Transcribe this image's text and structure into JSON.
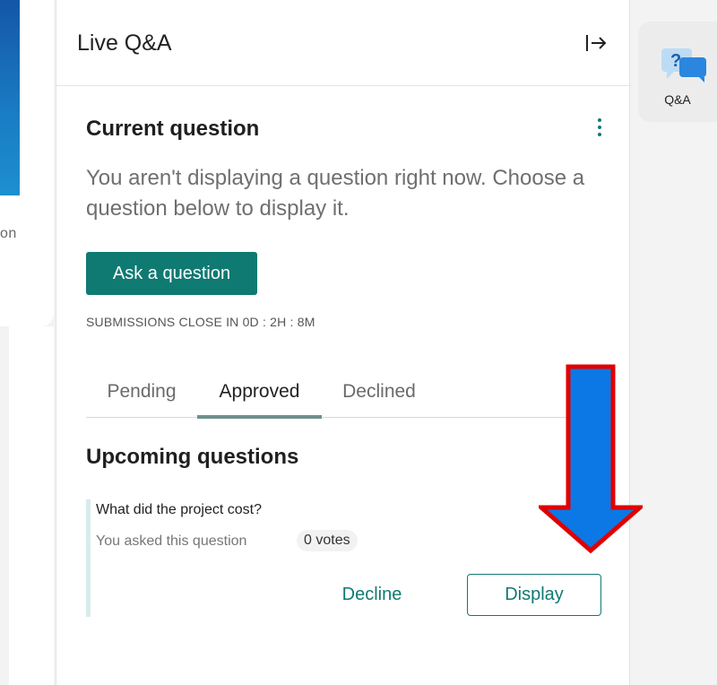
{
  "left_peek": {
    "text": "on"
  },
  "panel": {
    "title": "Live Q&A"
  },
  "current": {
    "title": "Current question",
    "message": "You aren't displaying a question right now. Choose a question below to display it.",
    "ask_button": "Ask a question",
    "countdown": "SUBMISSIONS CLOSE IN 0D : 2H : 8M"
  },
  "tabs": [
    {
      "label": "Pending",
      "active": false
    },
    {
      "label": "Approved",
      "active": true
    },
    {
      "label": "Declined",
      "active": false
    }
  ],
  "upcoming": {
    "title": "Upcoming questions",
    "questions": [
      {
        "text": "What did the project cost?",
        "asker": "You asked this question",
        "votes": "0 votes",
        "decline_label": "Decline",
        "display_label": "Display"
      }
    ]
  },
  "rail": {
    "qa_label": "Q&A"
  },
  "colors": {
    "accent": "#0f7a72",
    "arrow_fill": "#0b78e6",
    "arrow_stroke": "#e00000"
  },
  "icons": {
    "collapse": "collapse-panel-icon",
    "more": "more-vertical-icon",
    "qa": "qa-chat-icon",
    "annotation": "down-arrow-annotation"
  }
}
